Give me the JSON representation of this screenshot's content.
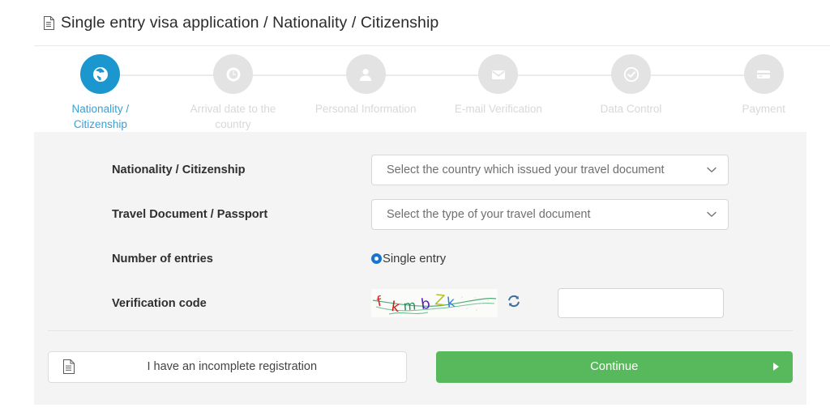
{
  "header": {
    "icon": "document-icon",
    "title": "Single entry visa application / Nationality / Citizenship"
  },
  "stepper": {
    "steps": [
      {
        "label": "Nationality / Citizenship",
        "icon": "globe-icon",
        "active": true
      },
      {
        "label": "Arrival date to the country",
        "icon": "clock-icon",
        "active": false
      },
      {
        "label": "Personal Information",
        "icon": "person-icon",
        "active": false
      },
      {
        "label": "E-mail Verification",
        "icon": "envelope-icon",
        "active": false
      },
      {
        "label": "Data Control",
        "icon": "check-circle-icon",
        "active": false
      },
      {
        "label": "Payment",
        "icon": "credit-card-icon",
        "active": false
      }
    ]
  },
  "form": {
    "nationality": {
      "label": "Nationality / Citizenship",
      "placeholder": "Select the country which issued your travel document",
      "value": ""
    },
    "travel_document": {
      "label": "Travel Document / Passport",
      "placeholder": "Select the type of your travel document",
      "value": ""
    },
    "entries": {
      "label": "Number of entries",
      "option_label": "Single entry",
      "selected": true
    },
    "verification": {
      "label": "Verification code",
      "captcha_text": "fkmbZk",
      "refresh_icon": "refresh-icon",
      "input_value": ""
    }
  },
  "actions": {
    "incomplete_label": "I have an incomplete registration",
    "incomplete_icon": "document-icon",
    "continue_label": "Continue",
    "continue_icon": "arrow-right-icon"
  },
  "colors": {
    "accent_blue": "#1b96ce",
    "active_label_blue": "#3a9fd4",
    "radio_blue": "#1874d2",
    "continue_green": "#58b85c",
    "panel_bg": "#f4f4f4",
    "inactive_gray": "#e3e3e3"
  }
}
